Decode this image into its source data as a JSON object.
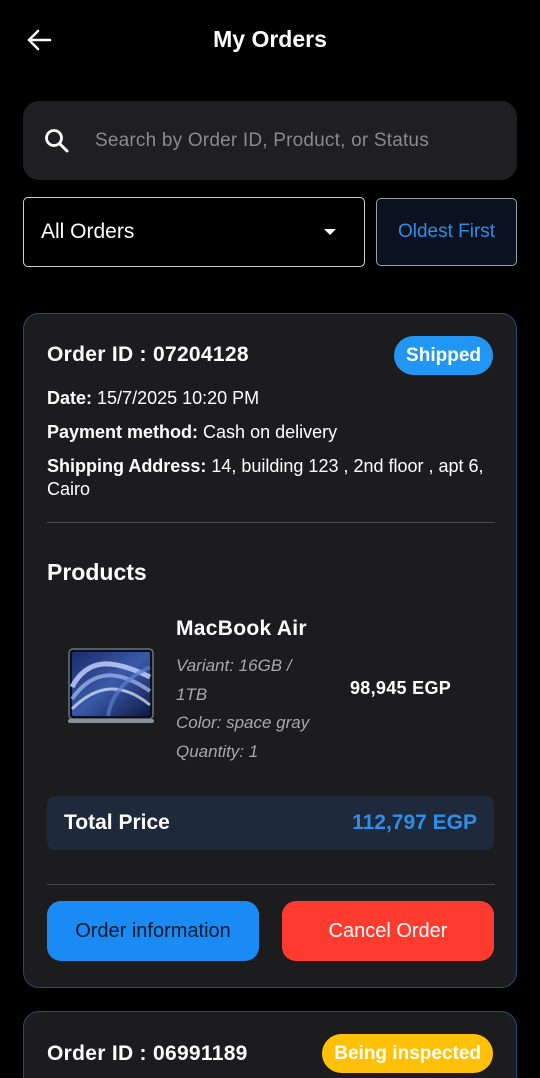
{
  "header": {
    "title": "My Orders"
  },
  "search": {
    "placeholder": "Search by Order ID, Product, or Status"
  },
  "filter": {
    "selected": "All Orders"
  },
  "sort": {
    "label": "Oldest First"
  },
  "orders": [
    {
      "id_label": "Order ID : 07204128",
      "status": "Shipped",
      "date_label": "Date:",
      "date_value": "15/7/2025 10:20 PM",
      "payment_label": "Payment method:",
      "payment_value": "Cash on delivery",
      "shipping_label": "Shipping Address:",
      "shipping_value": "14, building 123 , 2nd floor , apt 6, Cairo",
      "products_title": "Products",
      "products": [
        {
          "name": "MacBook Air",
          "variant": "Variant: 16GB / 1TB",
          "color": "Color: space gray",
          "quantity": "Quantity: 1",
          "price": "98,945 EGP"
        }
      ],
      "total_label": "Total Price",
      "total_value": "112,797 EGP",
      "info_button": "Order information",
      "cancel_button": "Cancel Order"
    },
    {
      "id_label": "Order ID : 06991189",
      "status": "Being inspected"
    }
  ],
  "colors": {
    "background": "#000000",
    "card": "#1c1c1e",
    "accent": "#2f8ee8",
    "shipped": "#2196f3",
    "inspecting": "#ffc107",
    "cancel": "#ff3b30"
  },
  "icons": {
    "back": "arrow-left-icon",
    "search": "search-icon",
    "dropdown": "caret-down-icon"
  }
}
